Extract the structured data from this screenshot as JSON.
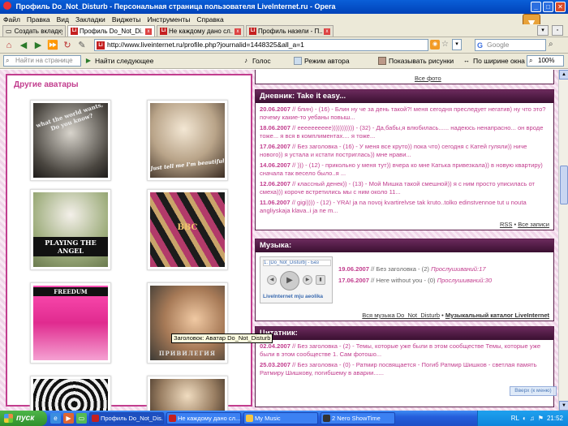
{
  "window": {
    "title": "Профиль Do_Not_Disturb - Персональная страница пользователя LiveInternet.ru - Opera"
  },
  "menu": [
    "Файл",
    "Правка",
    "Вид",
    "Закладки",
    "Виджеты",
    "Инструменты",
    "Справка"
  ],
  "tabs": {
    "new_tab": "Создать вкладку",
    "items": [
      {
        "label": "Профиль Do_Not_Di...",
        "active": true
      },
      {
        "label": "Не каждому дано сл...",
        "active": false
      },
      {
        "label": "Профиль назели - П...",
        "active": false
      }
    ]
  },
  "address": {
    "url": "http://www.liveinternet.ru/profile.php?journalid=1448325&all_a=1",
    "search_placeholder": "Google"
  },
  "findbar": {
    "placeholder": "Найти на странице",
    "find_next": "Найти следующее",
    "voice": "Голос",
    "author_mode": "Режим автора",
    "show_images": "Показывать рисунки",
    "fit_width": "По ширине окна",
    "zoom": "100%"
  },
  "avatars": {
    "title": "Другие аватары",
    "tile_texts": [
      "what the world wants, Do you know?",
      "Just tell me I'm beautiful",
      "PLAYING THE ANGEL",
      "BBC",
      "FREEDUM",
      "ПРИВИЛЕГИЯ"
    ]
  },
  "tooltip": "Заголовок: Аватар Do_Not_Disturb",
  "photos_link": "Все фото",
  "diary": {
    "title": "Дневник: Take it easy...",
    "entries": [
      {
        "date": "20.06.2007",
        "text": " // блин) - (16) - Блин ну че за день такой?! меня сегодня преследует негатив) ну что это? почему какие-то уебаны повыш..."
      },
      {
        "date": "18.06.2007",
        "text": " // ееееееееее))))))))))) - (32) - Да,бабы,я влюбилась...... надеюсь ненапрасно... он вроде тоже... я вся в комплиментах.... я тоже..."
      },
      {
        "date": "17.06.2007",
        "text": " // Без заголовка - (16) - У меня все круто)) пока что) сегодня с Катей гуляли)) ниче нового)) я устала и кстати постриглась)) мне нрави..."
      },
      {
        "date": "14.06.2007",
        "text": " // ))) - (12) - прикольно у меня тут)) вчера ко мне Катька привезкала)) в новую квартиру) сначала так весело было..я ..."
      },
      {
        "date": "12.06.2007",
        "text": " // классный денек)) - (13) - Мой Мишка такой смешной)) я с ним просто уписилась от смеха))) короче встретились мы с ним около 11..."
      },
      {
        "date": "11.06.2007",
        "text": " // gigi)))) - (12) - YRA! ja na novoj kvartirelvse tak kruto..tolko edinstvennoe tut u nouta angliyskaja klava..i ja ne m..."
      }
    ],
    "rss": "RSS",
    "all_entries": "Все записи"
  },
  "music": {
    "title": "Музыка:",
    "player_track": "1. [Do_Not_Disturb] - Без",
    "player_brand": "LiveInternet  mju aeolika",
    "entries": [
      {
        "date": "19.06.2007",
        "text": " // Без заголовка - (2) ",
        "plays": "Прослушиваний:17"
      },
      {
        "date": "17.06.2007",
        "text": " // Here without you - (0) ",
        "plays": "Прослушиваний:30"
      }
    ],
    "footer_all": "Вся музыка Do_Not_Disturb",
    "footer_catalog": "Музыкальный каталог LiveInternet"
  },
  "quotes": {
    "title": "Цитатник:",
    "entries": [
      {
        "date": "02.04.2007",
        "text": " // Без заголовка - (2) - Темы, которые уже были в этом сообществе Темы, которые уже были в этом сообществе 1. Сам фотошо..."
      },
      {
        "date": "25.03.2007",
        "text": " // Без заголовка - (0) - Ратмир посвящается - Погиб Ратмир Шишков - светлая память Ратмиру Шишкову, погибшему в аварии......"
      }
    ]
  },
  "backtop": "Вверх (к меню)",
  "taskbar": {
    "start": "пуск",
    "items": [
      {
        "label": "Профиль Do_Not_Dis...",
        "active": true,
        "color": "#c52020"
      },
      {
        "label": "Не каждому дано сл...",
        "active": false,
        "color": "#c52020"
      },
      {
        "label": "My Music",
        "active": false,
        "color": "#f5c542"
      },
      {
        "label": "2 Nero ShowTime",
        "active": false,
        "color": "#333"
      }
    ],
    "lang": "RL",
    "time": "21:52"
  }
}
